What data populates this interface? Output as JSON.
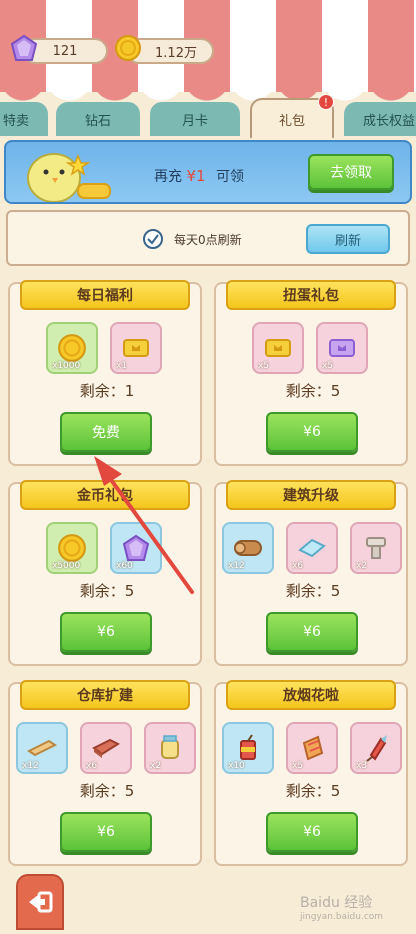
{
  "resources": {
    "gems": "121",
    "coins": "1.12万"
  },
  "tabs": [
    {
      "label": "特卖"
    },
    {
      "label": "钻石"
    },
    {
      "label": "月卡"
    },
    {
      "label": "礼包",
      "badge": "!"
    },
    {
      "label": "成长权益"
    }
  ],
  "banner": {
    "prefix": "再充",
    "amount": "¥1",
    "suffix": "可领",
    "button": "去领取"
  },
  "refresh": {
    "text": "每天0点刷新",
    "button": "刷新"
  },
  "cards": [
    {
      "title": "每日福利",
      "items": [
        {
          "icon": "coin-icon",
          "count": "x1000"
        },
        {
          "icon": "ticket-icon",
          "count": "x1"
        }
      ],
      "remain": "剩余：1",
      "button": "免费"
    },
    {
      "title": "扭蛋礼包",
      "items": [
        {
          "icon": "ticket-icon",
          "count": "x5"
        },
        {
          "icon": "purple-ticket-icon",
          "count": "x5"
        }
      ],
      "remain": "剩余：5",
      "button": "¥6"
    },
    {
      "title": "金币礼包",
      "items": [
        {
          "icon": "coin-icon",
          "count": "x5000"
        },
        {
          "icon": "gem-icon",
          "count": "x60"
        }
      ],
      "remain": "剩余：5",
      "button": "¥6"
    },
    {
      "title": "建筑升级",
      "items": [
        {
          "icon": "log-icon",
          "count": "x12"
        },
        {
          "icon": "glass-icon",
          "count": "x6"
        },
        {
          "icon": "stone-icon",
          "count": "x2"
        }
      ],
      "remain": "剩余：5",
      "button": "¥6"
    },
    {
      "title": "仓库扩建",
      "items": [
        {
          "icon": "plank-icon",
          "count": "x12"
        },
        {
          "icon": "brick-icon",
          "count": "x6"
        },
        {
          "icon": "jar-icon",
          "count": "x2"
        }
      ],
      "remain": "剩余：5",
      "button": "¥6"
    },
    {
      "title": "放烟花啦",
      "items": [
        {
          "icon": "firecracker-icon",
          "count": "x10"
        },
        {
          "icon": "firework-box-icon",
          "count": "x5"
        },
        {
          "icon": "rocket-icon",
          "count": "x3"
        }
      ],
      "remain": "剩余：5",
      "button": "¥6"
    }
  ],
  "watermark": {
    "main": "Baidu 经验",
    "sub": "jingyan.baidu.com"
  },
  "colors": {
    "accent_green": "#5cc33a",
    "tab_teal": "#7cb9b2",
    "awning_red": "#e98a86",
    "arrow_red": "#e3483f"
  }
}
